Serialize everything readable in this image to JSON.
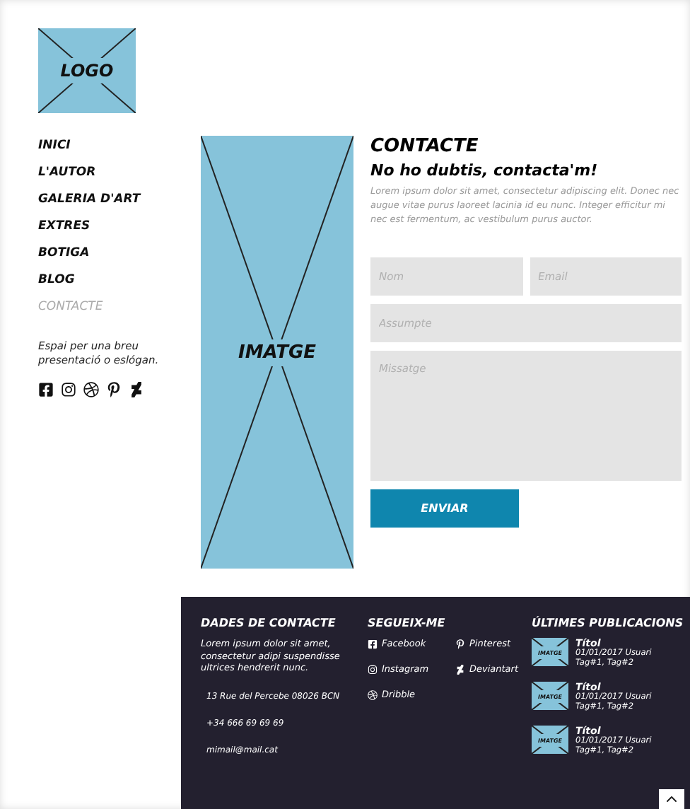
{
  "logo": {
    "label": "LOGO"
  },
  "nav": [
    {
      "label": "INICI",
      "selected": false
    },
    {
      "label": "L'AUTOR",
      "selected": false
    },
    {
      "label": "GALERIA D'ART",
      "selected": false
    },
    {
      "label": "EXTRES",
      "selected": false
    },
    {
      "label": "BOTIGA",
      "selected": false
    },
    {
      "label": "BLOG",
      "selected": false
    },
    {
      "label": "CONTACTE",
      "selected": true
    }
  ],
  "slogan": "Espai per una breu presentació o eslógan.",
  "social_icons": [
    {
      "kind": "facebook"
    },
    {
      "kind": "instagram"
    },
    {
      "kind": "dribbble"
    },
    {
      "kind": "pinterest"
    },
    {
      "kind": "deviantart"
    }
  ],
  "image": {
    "label": "IMATGE"
  },
  "contact": {
    "title": "CONTACTE",
    "subtitle": "No ho dubtis, contacta'm!",
    "text": "Lorem ipsum dolor sit amet, consectetur adipiscing elit. Donec nec augue vitae purus laoreet lacinia id eu nunc. Integer efficitur mi nec est fermentum, ac vestibulum purus auctor.",
    "fields": [
      {
        "placeholder": "Nom"
      },
      {
        "placeholder": "Email"
      },
      {
        "placeholder": "Assumpte"
      },
      {
        "placeholder": "Missatge"
      }
    ],
    "button": "ENVIAR"
  },
  "footer": {
    "contact": {
      "title": "DADES DE CONTACTE",
      "text": "Lorem ipsum dolor sit amet, consectetur adipi suspendisse ultrices hendrerit nunc.",
      "address": "13 Rue del Percebe 08026 BCN",
      "phone": "+34 666 69 69 69",
      "email": "mimail@mail.cat"
    },
    "follow": {
      "title": "SEGUEIX-ME",
      "links": [
        {
          "kind": "facebook",
          "label": "Facebook"
        },
        {
          "kind": "pinterest",
          "label": "Pinterest"
        },
        {
          "kind": "instagram",
          "label": "Instagram"
        },
        {
          "kind": "deviantart",
          "label": "Deviantart"
        },
        {
          "kind": "dribbble",
          "label": "Dribble"
        }
      ]
    },
    "posts": {
      "title": "ÚLTIMES PUBLICACIONS",
      "items": [
        {
          "thumb": "IMATGE",
          "title": "Títol",
          "meta": "01/01/2017 Usuari",
          "tags": "Tag#1, Tag#2"
        },
        {
          "thumb": "IMATGE",
          "title": "Títol",
          "meta": "01/01/2017 Usuari",
          "tags": "Tag#1, Tag#2"
        },
        {
          "thumb": "IMATGE",
          "title": "Títol",
          "meta": "01/01/2017 Usuari",
          "tags": "Tag#1, Tag#2"
        }
      ]
    }
  }
}
